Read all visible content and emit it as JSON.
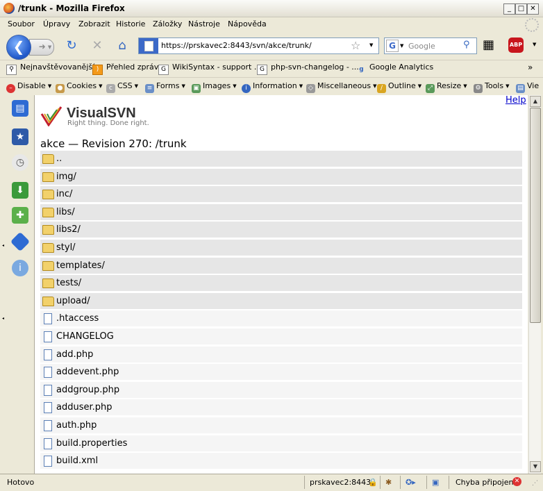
{
  "window": {
    "title": "/trunk - Mozilla Firefox"
  },
  "menu": [
    "Soubor",
    "Úpravy",
    "Zobrazit",
    "Historie",
    "Záložky",
    "Nástroje",
    "Nápověda"
  ],
  "navigation": {
    "url": "https://prskavec2:8443/svn/akce/trunk/",
    "search_placeholder": "Google"
  },
  "bookmarks": [
    "Nejnavštěvovanější",
    "Přehled zpráv",
    "WikiSyntax - support ...",
    "php-svn-changelog - ...",
    "Google Analytics"
  ],
  "webdev_toolbar": [
    "Disable",
    "Cookies",
    "CSS",
    "Forms",
    "Images",
    "Information",
    "Miscellaneous",
    "Outline",
    "Resize",
    "Tools",
    "Vie"
  ],
  "page": {
    "help_link": "Help",
    "brand": "VisualSVN",
    "tagline": "Right thing. Done right.",
    "heading": "akce — Revision 270: /trunk",
    "entries": [
      {
        "name": "..",
        "type": "folder"
      },
      {
        "name": "img/",
        "type": "folder"
      },
      {
        "name": "inc/",
        "type": "folder"
      },
      {
        "name": "libs/",
        "type": "folder"
      },
      {
        "name": "libs2/",
        "type": "folder"
      },
      {
        "name": "styl/",
        "type": "folder"
      },
      {
        "name": "templates/",
        "type": "folder"
      },
      {
        "name": "tests/",
        "type": "folder"
      },
      {
        "name": "upload/",
        "type": "folder"
      },
      {
        "name": ".htaccess",
        "type": "file"
      },
      {
        "name": "CHANGELOG",
        "type": "file"
      },
      {
        "name": "add.php",
        "type": "file"
      },
      {
        "name": "addevent.php",
        "type": "file"
      },
      {
        "name": "addgroup.php",
        "type": "file"
      },
      {
        "name": "adduser.php",
        "type": "file"
      },
      {
        "name": "auth.php",
        "type": "file"
      },
      {
        "name": "build.properties",
        "type": "file"
      },
      {
        "name": "build.xml",
        "type": "file"
      }
    ]
  },
  "statusbar": {
    "status": "Hotovo",
    "host": "prskavec2:8443",
    "connection": "Chyba připojení"
  },
  "icons": {
    "firefox": "firefox-icon",
    "back": "back-arrow-icon",
    "forward": "forward-arrow-icon",
    "reload": "reload-icon",
    "stop": "stop-icon",
    "home": "home-icon",
    "bookmark_star": "star-icon",
    "folder": "folder-icon",
    "file": "file-icon",
    "lock": "lock-icon",
    "adblock": "abp-icon"
  }
}
